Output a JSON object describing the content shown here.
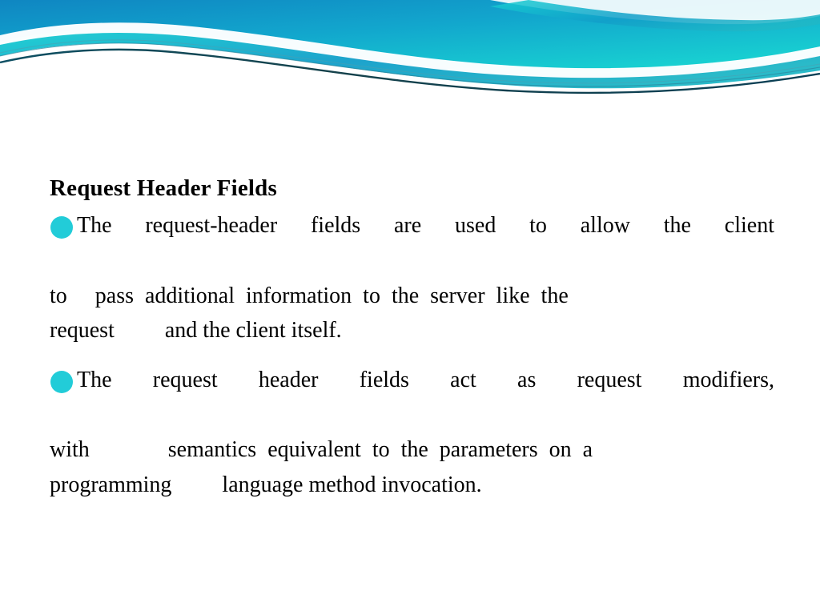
{
  "slide": {
    "title": "Request Header Fields",
    "background_color": "#ffffff",
    "text_color": "#000000",
    "bullet_color": "#22ccd8"
  },
  "banner": {
    "name": "wave-banner",
    "gradient_from": "#1186bf",
    "gradient_mid": "#12a9cf",
    "gradient_to": "#17d4d4",
    "accent_dark": "#0b4f66"
  },
  "bullets": [
    {
      "marker": "circle-bullet",
      "lines": [
        "The  request-header  fields  are  used  to  allow  the  client",
        "to     pass  additional  information  to  the  server  like  the",
        "request         and the client itself."
      ],
      "text": "The request-header fields are used to allow the client to  pass additional information to the server like the request      and the client itself."
    },
    {
      "marker": "circle-bullet",
      "lines": [
        "The   request   header   fields   act   as   request   modifiers,",
        "with              semantics  equivalent  to  the  parameters  on  a",
        "programming         language method invocation."
      ],
      "text": "The request header fields act as request modifiers, with        semantics equivalent to the parameters on a programming      language method invocation."
    }
  ]
}
